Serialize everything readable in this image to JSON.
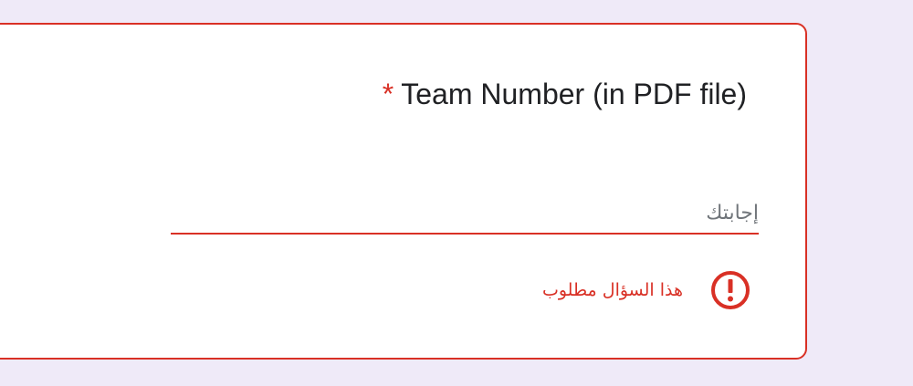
{
  "question": {
    "required_marker": "*",
    "title": "Team Number (in PDF file)"
  },
  "answer": {
    "placeholder": "إجابتك",
    "value": ""
  },
  "validation": {
    "message": "هذا السؤال مطلوب",
    "icon": "error-circle-icon"
  },
  "colors": {
    "error": "#d93025",
    "background": "#efeaf8",
    "card": "#ffffff"
  }
}
